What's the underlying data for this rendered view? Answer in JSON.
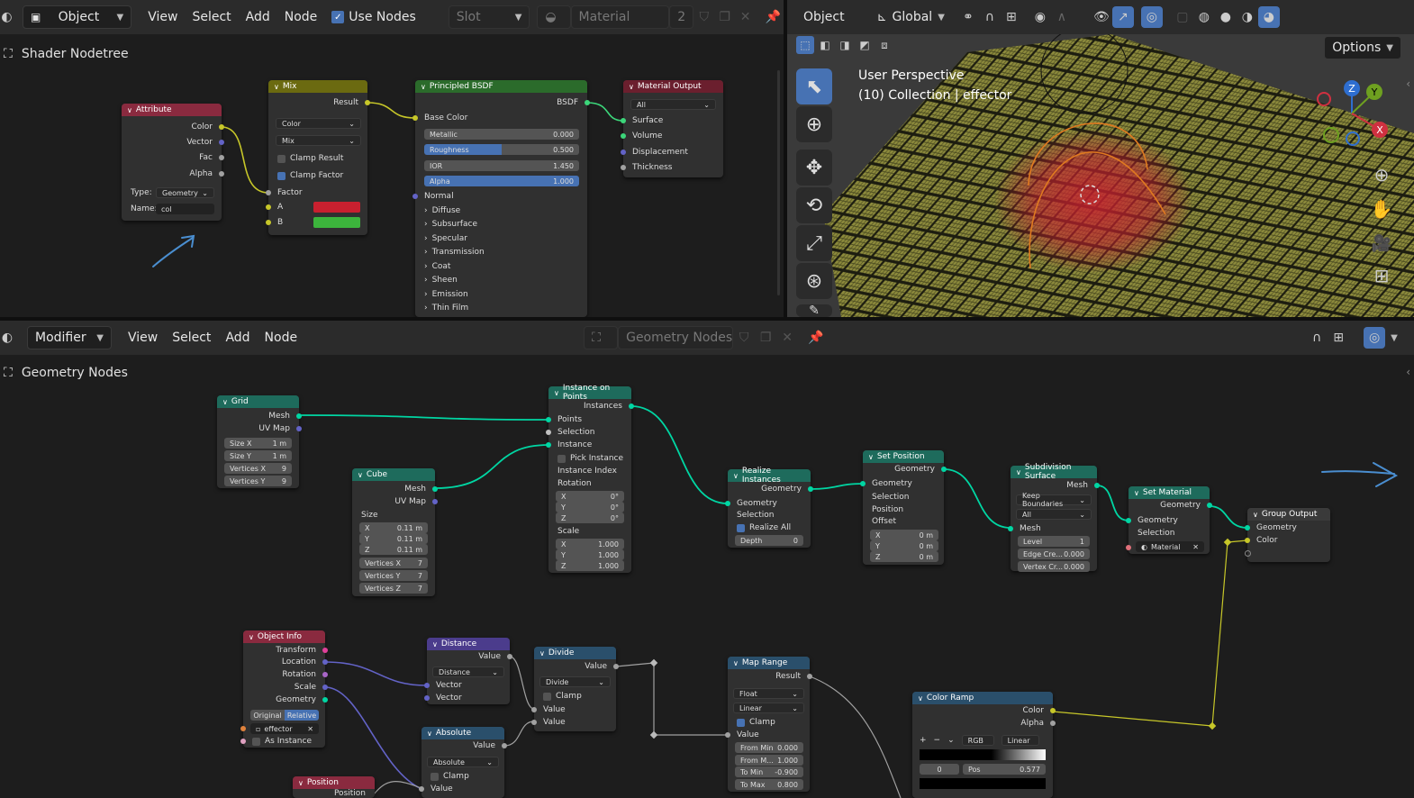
{
  "shader_editor": {
    "header": {
      "mode": "Object",
      "menus": [
        "View",
        "Select",
        "Add",
        "Node"
      ],
      "use_nodes_label": "Use Nodes",
      "slot_label": "Slot",
      "material_name": "Material",
      "user_count": "2"
    },
    "breadcrumb": "Shader Nodetree",
    "nodes": {
      "attribute": {
        "title": "Attribute",
        "outputs": [
          "Color",
          "Vector",
          "Fac",
          "Alpha"
        ],
        "type_label": "Type:",
        "type_value": "Geometry",
        "name_label": "Name:",
        "name_value": "col"
      },
      "mix": {
        "title": "Mix",
        "output": "Result",
        "data_type": "Color",
        "blend": "Mix",
        "clamp_result": "Clamp Result",
        "clamp_factor": "Clamp Factor",
        "inputs": [
          "Factor",
          "A",
          "B"
        ],
        "a_color": "#c8202f",
        "b_color": "#3cb43c"
      },
      "principled": {
        "title": "Principled BSDF",
        "output": "BSDF",
        "base_color": "Base Color",
        "fields": [
          {
            "label": "Metallic",
            "value": "0.000"
          },
          {
            "label": "Roughness",
            "value": "0.500"
          },
          {
            "label": "IOR",
            "value": "1.450"
          },
          {
            "label": "Alpha",
            "value": "1.000"
          }
        ],
        "normal": "Normal",
        "panels": [
          "Diffuse",
          "Subsurface",
          "Specular",
          "Transmission",
          "Coat",
          "Sheen",
          "Emission",
          "Thin Film"
        ]
      },
      "material_output": {
        "title": "Material Output",
        "target": "All",
        "inputs": [
          "Surface",
          "Volume",
          "Displacement",
          "Thickness"
        ]
      }
    }
  },
  "viewport": {
    "header": {
      "mode": "Object",
      "orientation": "Global",
      "options_label": "Options"
    },
    "perspective": "User Perspective",
    "collection": "(10) Collection | effector",
    "gizmo_axes": {
      "x": "X",
      "y": "Y",
      "z": "Z"
    }
  },
  "geometry_editor": {
    "header": {
      "context": "Modifier",
      "menus": [
        "View",
        "Select",
        "Add",
        "Node"
      ],
      "tree_name": "Geometry Nodes"
    },
    "breadcrumb": "Geometry Nodes",
    "nodes": {
      "grid": {
        "title": "Grid",
        "outputs": [
          "Mesh",
          "UV Map"
        ],
        "fields": [
          {
            "label": "Size X",
            "value": "1 m"
          },
          {
            "label": "Size Y",
            "value": "1 m"
          },
          {
            "label": "Vertices X",
            "value": "9"
          },
          {
            "label": "Vertices Y",
            "value": "9"
          }
        ]
      },
      "cube": {
        "title": "Cube",
        "outputs": [
          "Mesh",
          "UV Map"
        ],
        "size_label": "Size",
        "fields": [
          {
            "label": "X",
            "value": "0.11 m"
          },
          {
            "label": "Y",
            "value": "0.11 m"
          },
          {
            "label": "Z",
            "value": "0.11 m"
          },
          {
            "label": "Vertices X",
            "value": "7"
          },
          {
            "label": "Vertices Y",
            "value": "7"
          },
          {
            "label": "Vertices Z",
            "value": "7"
          }
        ]
      },
      "instance_on_points": {
        "title": "Instance on Points",
        "output": "Instances",
        "inputs": [
          "Points",
          "Selection",
          "Instance"
        ],
        "pick_instance": "Pick Instance",
        "instance_index": "Instance Index",
        "rotation": "Rotation",
        "rot_fields": [
          {
            "label": "X",
            "value": "0°"
          },
          {
            "label": "Y",
            "value": "0°"
          },
          {
            "label": "Z",
            "value": "0°"
          }
        ],
        "scale": "Scale",
        "scale_fields": [
          {
            "label": "X",
            "value": "1.000"
          },
          {
            "label": "Y",
            "value": "1.000"
          },
          {
            "label": "Z",
            "value": "1.000"
          }
        ]
      },
      "realize": {
        "title": "Realize Instances",
        "output": "Geometry",
        "inputs": [
          "Geometry",
          "Selection"
        ],
        "realize_all": "Realize All",
        "depth_label": "Depth",
        "depth_value": "0"
      },
      "set_position": {
        "title": "Set Position",
        "output": "Geometry",
        "inputs": [
          "Geometry",
          "Selection",
          "Position",
          "Offset"
        ],
        "fields": [
          {
            "label": "X",
            "value": "0 m"
          },
          {
            "label": "Y",
            "value": "0 m"
          },
          {
            "label": "Z",
            "value": "0 m"
          }
        ]
      },
      "subdivision": {
        "title": "Subdivision Surface",
        "output": "Mesh",
        "boundary": "Keep Boundaries",
        "uv": "All",
        "input_mesh": "Mesh",
        "fields": [
          {
            "label": "Level",
            "value": "1"
          },
          {
            "label": "Edge Cre...",
            "value": "0.000"
          },
          {
            "label": "Vertex Cr...",
            "value": "0.000"
          }
        ]
      },
      "set_material": {
        "title": "Set Material",
        "output": "Geometry",
        "inputs": [
          "Geometry",
          "Selection"
        ],
        "material": "Material"
      },
      "group_output": {
        "title": "Group Output",
        "inputs": [
          "Geometry",
          "Color"
        ]
      },
      "object_info": {
        "title": "Object Info",
        "outputs": [
          "Transform",
          "Location",
          "Rotation",
          "Scale",
          "Geometry"
        ],
        "toggle": [
          "Original",
          "Relative"
        ],
        "object": "effector",
        "as_instance": "As Instance"
      },
      "distance": {
        "title": "Distance",
        "output": "Value",
        "op": "Distance",
        "inputs": [
          "Vector",
          "Vector"
        ]
      },
      "divide": {
        "title": "Divide",
        "output": "Value",
        "op": "Divide",
        "clamp": "Clamp",
        "inputs": [
          "Value",
          "Value"
        ]
      },
      "absolute": {
        "title": "Absolute",
        "output": "Value",
        "op": "Absolute",
        "clamp": "Clamp",
        "input": "Value"
      },
      "map_range": {
        "title": "Map Range",
        "output": "Result",
        "data_type": "Float",
        "interp": "Linear",
        "clamp": "Clamp",
        "input": "Value",
        "fields": [
          {
            "label": "From Min",
            "value": "0.000"
          },
          {
            "label": "From M...",
            "value": "1.000"
          },
          {
            "label": "To Min",
            "value": "-0.900"
          },
          {
            "label": "To Max",
            "value": "0.800"
          }
        ]
      },
      "color_ramp": {
        "title": "Color Ramp",
        "outputs": [
          "Color",
          "Alpha"
        ],
        "mode": "RGB",
        "interp": "Linear",
        "index": "0",
        "pos_label": "Pos",
        "pos_value": "0.577"
      },
      "position": {
        "title": "Position",
        "output": "Position"
      }
    }
  },
  "colors": {
    "geometry_header": "#1e6b5c",
    "input_header": "#8a2a3f",
    "converter_header": "#2a4f6b",
    "vector_header": "#4b3c8c",
    "shader_header": "#2b6b2b",
    "color_header": "#6b6a10",
    "output_header": "#6b1f2e"
  }
}
